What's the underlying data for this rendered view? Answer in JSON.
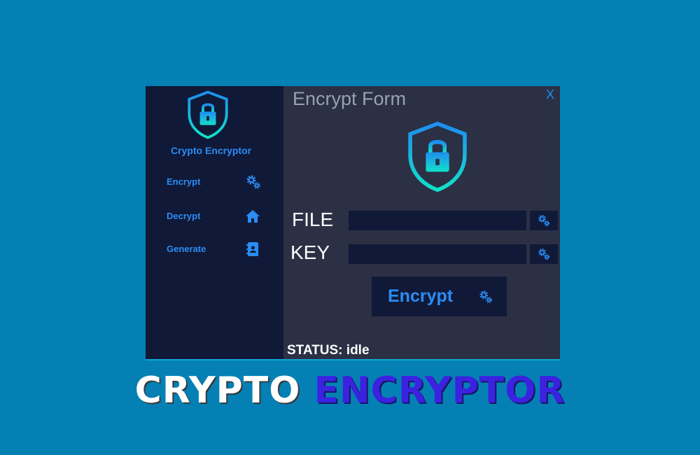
{
  "app": {
    "name": "Crypto Encryptor",
    "colors": {
      "accent": "#2b8cf5",
      "sidebar_bg": "#101937",
      "main_bg": "#2b3045",
      "page_bg": "#0580b4",
      "shield_gradient": [
        "#1e8ef0",
        "#12e0c8"
      ]
    }
  },
  "sidebar": {
    "items": [
      {
        "label": "Encrypt",
        "icon": "gears-icon"
      },
      {
        "label": "Decrypt",
        "icon": "home-icon"
      },
      {
        "label": "Generate",
        "icon": "address-book-icon"
      }
    ]
  },
  "form": {
    "title": "Encrypt Form",
    "close_label": "X",
    "file_label": "FILE",
    "file_value": "",
    "key_label": "KEY",
    "key_value": "",
    "submit_label": "Encrypt",
    "status": "STATUS: idle"
  },
  "banner": {
    "word1": "CRYPTO",
    "word2": "ENCRYPTOR"
  }
}
